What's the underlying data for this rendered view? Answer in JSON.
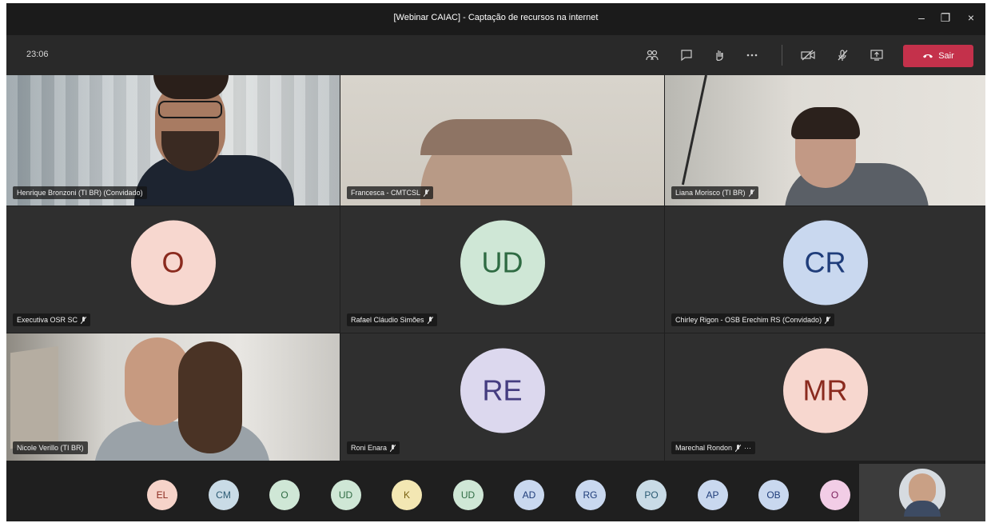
{
  "window": {
    "title": "[Webinar CAIAC] - Captação de recursos na internet",
    "controls": [
      "–",
      "❐",
      "×"
    ]
  },
  "toolbar": {
    "timer": "23:06",
    "leave_label": "Sair",
    "icons": [
      "participants-icon",
      "chat-icon",
      "raise-hand-icon",
      "more-options-icon",
      "camera-off-icon",
      "mic-off-icon",
      "share-screen-icon"
    ]
  },
  "participants_grid": [
    {
      "name": "Henrique Bronzoni (TI BR) (Convidado)",
      "video": true,
      "muted": false
    },
    {
      "name": "Francesca - CMTCSL",
      "video": true,
      "muted": true
    },
    {
      "name": "Liana Morisco (TI BR)",
      "video": true,
      "muted": true
    },
    {
      "name": "Executiva OSR SC",
      "initials": "O",
      "avatar_bg": "#f7d7cf",
      "avatar_fg": "#8a2a1e",
      "muted": true
    },
    {
      "name": "Rafael Cláudio Simões",
      "initials": "UD",
      "avatar_bg": "#cfe7d6",
      "avatar_fg": "#2f6b43",
      "muted": true
    },
    {
      "name": "Chirley Rigon - OSB Erechim RS (Convidado)",
      "initials": "CR",
      "avatar_bg": "#c9d8ef",
      "avatar_fg": "#1f3d7a",
      "muted": true
    },
    {
      "name": "Nicole Verillo (TI BR)",
      "video": true,
      "muted": false
    },
    {
      "name": "Roni Enara",
      "initials": "RE",
      "avatar_bg": "#dcd8ee",
      "avatar_fg": "#453d80",
      "muted": true
    },
    {
      "name": "Marechal Rondon",
      "initials": "MR",
      "avatar_bg": "#f7d7cf",
      "avatar_fg": "#8a2a1e",
      "muted": true,
      "more": "···"
    }
  ],
  "bottom_strip": [
    {
      "initials": "EL",
      "bg": "#f6d3c9",
      "fg": "#8a2a1e"
    },
    {
      "initials": "CM",
      "bg": "#c9dbe6",
      "fg": "#2b5a73"
    },
    {
      "initials": "O",
      "bg": "#cfe7d6",
      "fg": "#2f6b43"
    },
    {
      "initials": "UD",
      "bg": "#cfe7d6",
      "fg": "#2f6b43"
    },
    {
      "initials": "K",
      "bg": "#f3e7b3",
      "fg": "#7a6212"
    },
    {
      "initials": "UD",
      "bg": "#cfe7d6",
      "fg": "#2f6b43"
    },
    {
      "initials": "AD",
      "bg": "#c9d8ef",
      "fg": "#1f3d7a"
    },
    {
      "initials": "RG",
      "bg": "#c9d8ef",
      "fg": "#1f3d7a"
    },
    {
      "initials": "PO",
      "bg": "#c9dbe6",
      "fg": "#2b5a73"
    },
    {
      "initials": "AP",
      "bg": "#c9d8ef",
      "fg": "#1f3d7a"
    },
    {
      "initials": "OB",
      "bg": "#c9d8ef",
      "fg": "#1f3d7a"
    },
    {
      "initials": "O",
      "bg": "#f2cde6",
      "fg": "#7a1f5b"
    }
  ],
  "colors": {
    "leave_button": "#c4314b",
    "tile_bg": "#2f2f2f",
    "toolbar_bg": "#292929"
  }
}
